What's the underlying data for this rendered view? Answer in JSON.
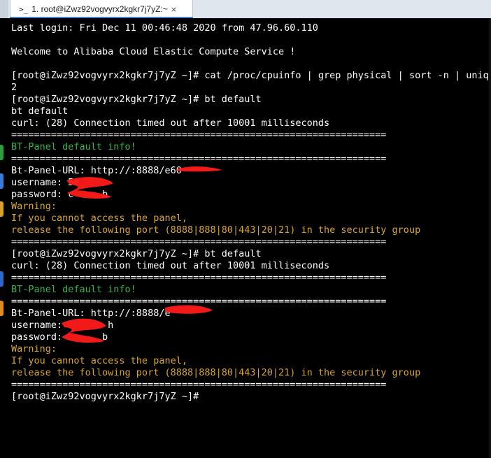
{
  "tab": {
    "prompt_icon": ">_",
    "title": "1. root@iZwz92vogvyrx2kgkr7j7yZ:~",
    "close": "×"
  },
  "colors": {
    "background": "#000000",
    "text": "#ffffff",
    "green": "#39b54a",
    "yellow": "#d9a626",
    "tab_accent": "#3c7fd1",
    "redaction": "#ff0000"
  },
  "terminal": {
    "lines": [
      {
        "text": "Last login: Fri Dec 11 00:46:48 2020 from 47.96.60.110",
        "color": "white"
      },
      {
        "text": "",
        "color": "white"
      },
      {
        "text": "Welcome to Alibaba Cloud Elastic Compute Service !",
        "color": "white"
      },
      {
        "text": "",
        "color": "white"
      },
      {
        "text": "[root@iZwz92vogvyrx2kgkr7j7yZ ~]# cat /proc/cpuinfo | grep physical | sort -n | uniq |",
        "color": "white"
      },
      {
        "text": "2",
        "color": "white"
      },
      {
        "text": "[root@iZwz92vogvyrx2kgkr7j7yZ ~]# bt default",
        "color": "white"
      },
      {
        "text": "bt default",
        "color": "white"
      },
      {
        "text": "curl: (28) Connection timed out after 10001 milliseconds",
        "color": "white"
      },
      {
        "text": "==================================================================",
        "color": "white"
      },
      {
        "text": "BT-Panel default info!",
        "color": "green"
      },
      {
        "text": "==================================================================",
        "color": "white"
      },
      {
        "text": "Bt-Panel-URL: http://:8888/e60",
        "color": "white"
      },
      {
        "text": "username: 5e",
        "color": "white"
      },
      {
        "text": "password: c     b",
        "color": "white"
      },
      {
        "text": "Warning:",
        "color": "yellow"
      },
      {
        "text": "If you cannot access the panel,",
        "color": "yellow"
      },
      {
        "text": "release the following port (8888|888|80|443|20|21) in the security group",
        "color": "yellow"
      },
      {
        "text": "==================================================================",
        "color": "white"
      },
      {
        "text": "[root@iZwz92vogvyrx2kgkr7j7yZ ~]# bt default",
        "color": "white"
      },
      {
        "text": "curl: (28) Connection timed out after 10001 milliseconds",
        "color": "white"
      },
      {
        "text": "==================================================================",
        "color": "white"
      },
      {
        "text": "BT-Panel default info!",
        "color": "green"
      },
      {
        "text": "==================================================================",
        "color": "white"
      },
      {
        "text": "Bt-Panel-URL: http://:8888/e",
        "color": "white"
      },
      {
        "text": "username:        h",
        "color": "white"
      },
      {
        "text": "password:       b",
        "color": "white"
      },
      {
        "text": "Warning:",
        "color": "yellow"
      },
      {
        "text": "If you cannot access the panel,",
        "color": "yellow"
      },
      {
        "text": "release the following port (8888|888|80|443|20|21) in the security group",
        "color": "yellow"
      },
      {
        "text": "==================================================================",
        "color": "white"
      },
      {
        "text": "[root@iZwz92vogvyrx2kgkr7j7yZ ~]#",
        "color": "white"
      }
    ]
  }
}
